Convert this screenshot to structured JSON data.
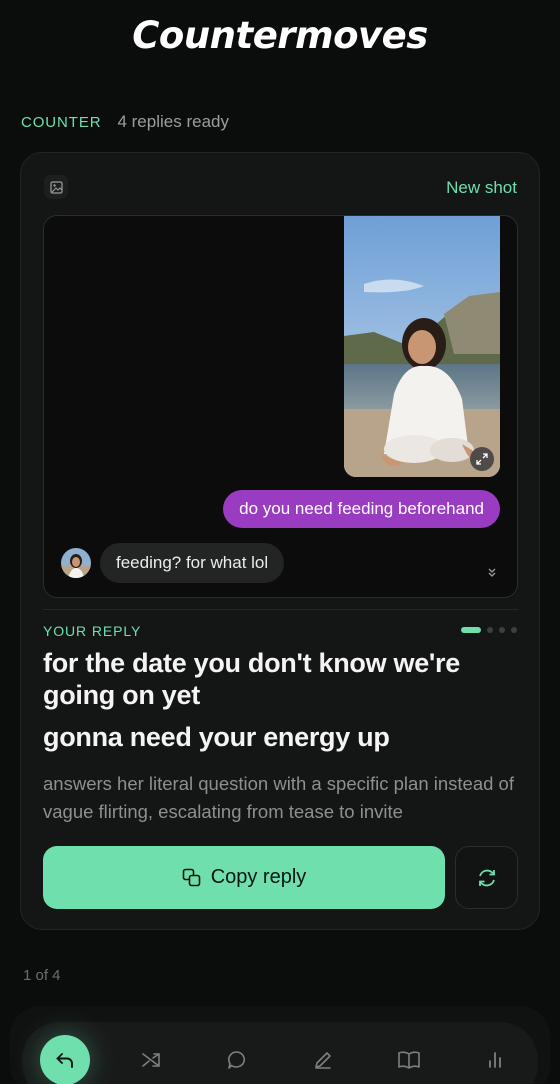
{
  "header": {
    "title": "Countermoves"
  },
  "meta": {
    "label": "COUNTER",
    "status": "4 replies ready"
  },
  "card": {
    "image_icon": "image-icon",
    "new_shot_label": "New shot",
    "screenshot": {
      "sent_message": "do you need feeding beforehand",
      "received_message": "feeding? for what lol"
    },
    "your_reply_label": "YOUR REPLY",
    "reply_index": 1,
    "reply_count": 4,
    "reply_line1": "for the date you don't know we're going on yet",
    "reply_line2": "gonna need your energy up",
    "explanation": "answers her literal question with a specific plan instead of vague flirting, escalating from tease to invite",
    "copy_label": "Copy reply"
  },
  "pager": {
    "text": "1 of 4"
  },
  "nav": {
    "items": [
      "reply-icon",
      "shuffle-icon",
      "chat-bubble-icon",
      "pencil-icon",
      "book-icon",
      "bar-chart-icon"
    ],
    "active_index": 0
  },
  "colors": {
    "accent": "#6fdfae",
    "sent_bubble": "#9a3cc1",
    "background": "#0b0d0c",
    "card": "#141615"
  }
}
